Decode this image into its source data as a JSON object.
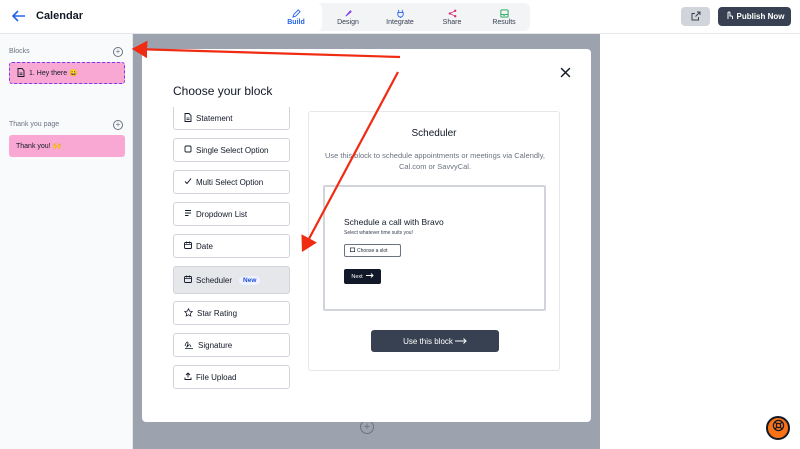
{
  "header": {
    "title": "Calendar",
    "tabs": [
      {
        "label": "Build",
        "icon": "pencil-icon"
      },
      {
        "label": "Design",
        "icon": "brush-icon"
      },
      {
        "label": "Integrate",
        "icon": "plug-icon"
      },
      {
        "label": "Share",
        "icon": "share-icon"
      },
      {
        "label": "Results",
        "icon": "inbox-icon"
      }
    ],
    "publish_label": "Publish Now"
  },
  "sidebar": {
    "blocks_heading": "Blocks",
    "blocks": [
      {
        "label": "1. Hey there 😀"
      }
    ],
    "thankyou_heading": "Thank you page",
    "thankyou_items": [
      {
        "label": "Thank you! 🙌"
      }
    ]
  },
  "modal": {
    "title": "Choose your block",
    "options": [
      {
        "label": "Statement",
        "icon": "doc-icon"
      },
      {
        "label": "Single Select Option",
        "icon": "square-icon"
      },
      {
        "label": "Multi Select Option",
        "icon": "check-icon"
      },
      {
        "label": "Dropdown List",
        "icon": "list-icon"
      },
      {
        "label": "Date",
        "icon": "calendar-icon"
      },
      {
        "label": "Scheduler",
        "icon": "calendar-icon",
        "badge": "New",
        "selected": true
      },
      {
        "label": "Star Rating",
        "icon": "star-icon"
      },
      {
        "label": "Signature",
        "icon": "signature-icon"
      },
      {
        "label": "File Upload",
        "icon": "upload-icon"
      }
    ],
    "preview": {
      "title": "Scheduler",
      "description": "Use this block to schedule appointments or meetings via Calendly, Cal.com or SavvyCal.",
      "sample_heading": "Schedule a call with Bravo",
      "sample_sub": "Select whatever time suits you!",
      "sample_slot": "Choose a slot",
      "sample_next": "Next",
      "use_label": "Use this block"
    }
  },
  "colors": {
    "accent": "#2563eb",
    "block_pink": "#f9a8d4",
    "annotation": "#ef2b12",
    "dark_button": "#374151"
  }
}
